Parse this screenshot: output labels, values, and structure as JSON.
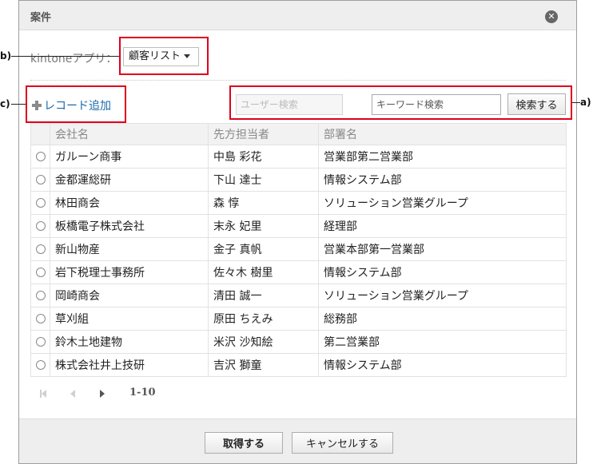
{
  "dialog": {
    "title": "案件",
    "close_icon": "close-icon"
  },
  "app_picker": {
    "label": "kintoneアプリ：",
    "selected": "顧客リスト"
  },
  "toolbar": {
    "add_record": "レコード追加",
    "user_search_placeholder": "ユーザー検索",
    "keyword_placeholder": "キーワード検索",
    "search_button": "検索する"
  },
  "table": {
    "headers": [
      "会社名",
      "先方担当者",
      "部署名"
    ],
    "rows": [
      [
        "ガルーン商事",
        "中島 彩花",
        "営業部第二営業部"
      ],
      [
        "金都運総研",
        "下山 達士",
        "情報システム部"
      ],
      [
        "林田商会",
        "森 惇",
        "ソリューション営業グループ"
      ],
      [
        "板橋電子株式会社",
        "末永 妃里",
        "経理部"
      ],
      [
        "新山物産",
        "金子 真帆",
        "営業本部第一営業部"
      ],
      [
        "岩下税理士事務所",
        "佐々木 樹里",
        "情報システム部"
      ],
      [
        "岡崎商会",
        "清田 誠一",
        "ソリューション営業グループ"
      ],
      [
        "草刈組",
        "原田 ちえみ",
        "総務部"
      ],
      [
        "鈴木土地建物",
        "米沢 沙知絵",
        "第二営業部"
      ],
      [
        "株式会社井上技研",
        "吉沢 獅童",
        "情報システム部"
      ]
    ]
  },
  "pager": {
    "range": "1-10"
  },
  "footer": {
    "ok_button": "取得する",
    "cancel_button": "キャンセルする"
  },
  "annotations": {
    "a": "a)",
    "b": "b)",
    "c": "c)",
    "color": "#e0001b"
  }
}
